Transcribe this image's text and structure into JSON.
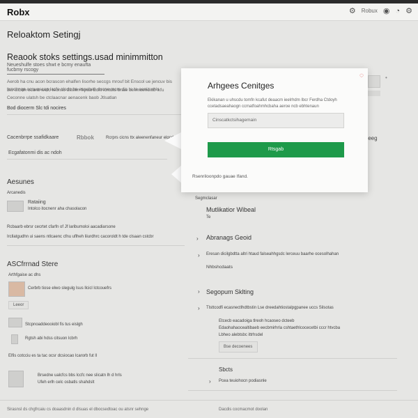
{
  "app": {
    "logo": "Robx"
  },
  "topbar": {
    "icons": [
      "gear-icon",
      "robux-icon",
      "user-icon",
      "bell-icon",
      "gear-icon"
    ],
    "balance": "Robux"
  },
  "page": {
    "title": "Reloaktom Setingj",
    "section_title": "Reaook stoks settings.usad minimmitton",
    "tab_text": "Neueshulfe stoes shwt e bcmy enaufta fucbmy rscogy",
    "para1": "Aerob ha cnu acon bcrascon ehalfen lisorhe seccgs mrouf bit Enscol ue jencuv bis tunchnqa ocnuuscop lacfe clodc ha esseheb dscne mcm dis te ta aeniz ehis",
    "para2": "Bw ulcxth ocanb wefo teonilo dlitelin fkpua Eckt icntulu bnae cenmcenolob lkfu Ceconne ulatsh be ctclaacnar aenacenk baob Jtlsatlan",
    "smallhead": "Bod diocerm Slc tdi nocires",
    "row_label": "Cacenbrrpe ssafidkaare",
    "row_value": "Rbbok",
    "row_hint": "Rcrprs cicns ttx aleenenfaneur elgcds",
    "row_right": "Ieeg",
    "sub_label": "Ecgafatonmi dis ac ndoh"
  },
  "left": {
    "acc_title": "Aesunes",
    "acc_sub": "Arcanedis",
    "acc_item": "Rataiing",
    "acc_item_sub": "Intolco itocnenr aha chasolacon",
    "acc_line1": "Rcbaarb ebrsr cecrtet cfarfn of Jf laribumoloi aacadiarsone",
    "acc_line2": "Ircllatgudhn ui saens ntlcaenc cfnu uflheh liiurdhrc cacoroldt h tde clsaan cstcbr",
    "store_title": "ASCfrrnad Stere",
    "store_sub": "Arthfgaise ac dhs",
    "store_item1": "Cerbrb tiose elwo slegulg lsus llcicl lctcouefrs",
    "store_chip": "Leeor",
    "store_item2": "Stcpnoaddeooiobl fis tus eislgh",
    "store_item3": "Rgtsh abi hdss citsuon lcbrh",
    "store_line": "Elfis cotcciu es ta tac ocsr dcsiocao lcarorb fut ll",
    "store_item4": "Brsedne ualcfcs bbs lccfc nee slicatn lh d hrls",
    "store_item4b": "Ufeh erlh celc osbatls shahdslt"
  },
  "right": {
    "label_top": "Segmclasar",
    "h_mult": "Mutlikatior Wibeal",
    "mult_sub": "Te",
    "h_adv": "Abranags Geoid",
    "adv_line": "Eresan dicilgbdtta altri htaud falseahhgsdc lerceuu baarhe ocesolhahan",
    "adv_sub": "Nhbshcdaats",
    "h_sec": "Segopum Sklting",
    "sec_line": "Tlsttcodfi ecasnectlhdtbstin Lse dreedahtiostalpgpanee uccs Silsotas",
    "sec_item1": "Etcecb eacadoiga tlreoh hcaoseo dcteeb",
    "sec_item1b": "Edaohahaocealtibaeb eecbmirhrla cshtaethlcocecetbi cccr htvcba",
    "sec_item2": "Lbheo alebtsbc ittrhsdel",
    "sec_btn": "Bse decoenees",
    "h_stu": "Sbcts",
    "stu_line": "Pcea teuiohocn podiasnle"
  },
  "modal": {
    "title": "Arhgees Cenitges",
    "desc": "Ekikanan u uhscdu tomfn kcafut deaacm ieelrhdm Ibcr Ferdha Ctdoyh ccetadsaeahaogn ccmatfoahmhcbaha aeroe ncb ebhtenaun",
    "input_value": "Cinscatkctsihagemain",
    "button_label": "Rtsgab",
    "footer": "Rsenriloonpdo gauae Ifand."
  },
  "footer": {
    "left": "Sirasnsl ds chgfrcaiu cs doaasdnin d dlsuas el dbocsedtoac ou atsnr sehnge",
    "right": "Dacdis cocmacmot doolan"
  },
  "colors": {
    "accent_green": "#1e9a4a",
    "close_red": "#dd4444",
    "modal_bg": "#fbfbfa",
    "page_bg": "#e6e6e4"
  }
}
